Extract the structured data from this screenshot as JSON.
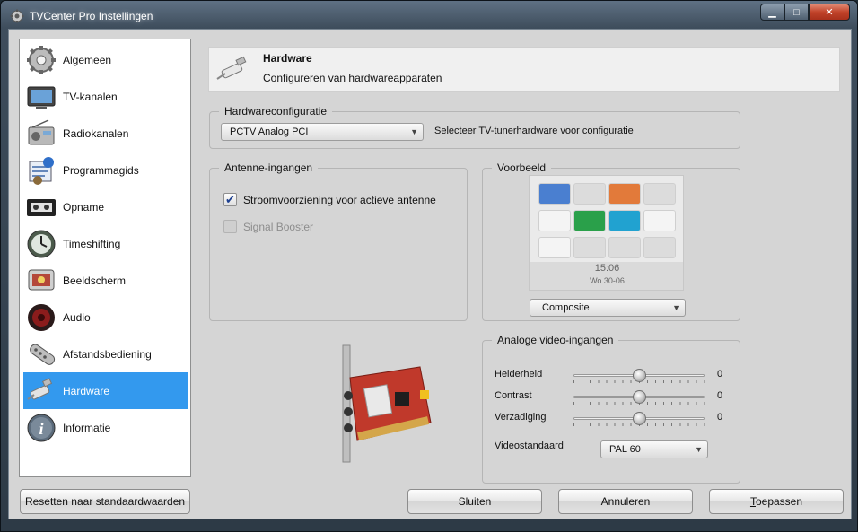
{
  "window": {
    "title": "TVCenter Pro Instellingen"
  },
  "sidebar": {
    "items": [
      {
        "label": "Algemeen",
        "icon": "gear-icon",
        "active": false
      },
      {
        "label": "TV-kanalen",
        "icon": "tv-icon",
        "active": false
      },
      {
        "label": "Radiokanalen",
        "icon": "radio-icon",
        "active": false
      },
      {
        "label": "Programmagids",
        "icon": "program-guide-icon",
        "active": false
      },
      {
        "label": "Opname",
        "icon": "videotape-icon",
        "active": false
      },
      {
        "label": "Timeshifting",
        "icon": "timeshift-dial-icon",
        "active": false
      },
      {
        "label": "Beeldscherm",
        "icon": "display-icon",
        "active": false
      },
      {
        "label": "Audio",
        "icon": "speaker-icon",
        "active": false
      },
      {
        "label": "Afstandsbediening",
        "icon": "remote-control-icon",
        "active": false
      },
      {
        "label": "Hardware",
        "icon": "usb-stick-icon",
        "active": true
      },
      {
        "label": "Informatie",
        "icon": "info-icon",
        "active": false
      }
    ]
  },
  "header": {
    "title": "Hardware",
    "subtitle": "Configureren van hardwareapparaten",
    "icon": "usb-stick-icon"
  },
  "hardware_config": {
    "legend": "Hardwareconfiguratie",
    "selected_device": "PCTV Analog PCI",
    "hint": "Selecteer TV-tunerhardware voor configuratie"
  },
  "antenna": {
    "legend": "Antenne-ingangen",
    "power_label": "Stroomvoorziening voor actieve antenne",
    "power_checked": true,
    "booster_label": "Signal Booster",
    "booster_checked": false,
    "booster_enabled": false
  },
  "preview": {
    "legend": "Voorbeeld",
    "clock_time": "15:06",
    "clock_date": "Wo 30-06",
    "input_selected": "Composite"
  },
  "analog_video": {
    "legend": "Analoge video-ingangen",
    "sliders": [
      {
        "label": "Helderheid",
        "value": "0",
        "position": 0.5
      },
      {
        "label": "Contrast",
        "value": "0",
        "position": 0.5
      },
      {
        "label": "Verzadiging",
        "value": "0",
        "position": 0.5
      }
    ],
    "videostandard_label": "Videostandaard",
    "videostandard_selected": "PAL 60"
  },
  "buttons": {
    "reset": "Resetten naar standaardwaarden",
    "close": "Sluiten",
    "cancel": "Annuleren",
    "apply_first": "T",
    "apply_rest": "oepassen"
  },
  "colors": {
    "active_nav": "#3399ee",
    "panel_bg": "#d5d5d5",
    "checkmark": "#1c3f90"
  }
}
